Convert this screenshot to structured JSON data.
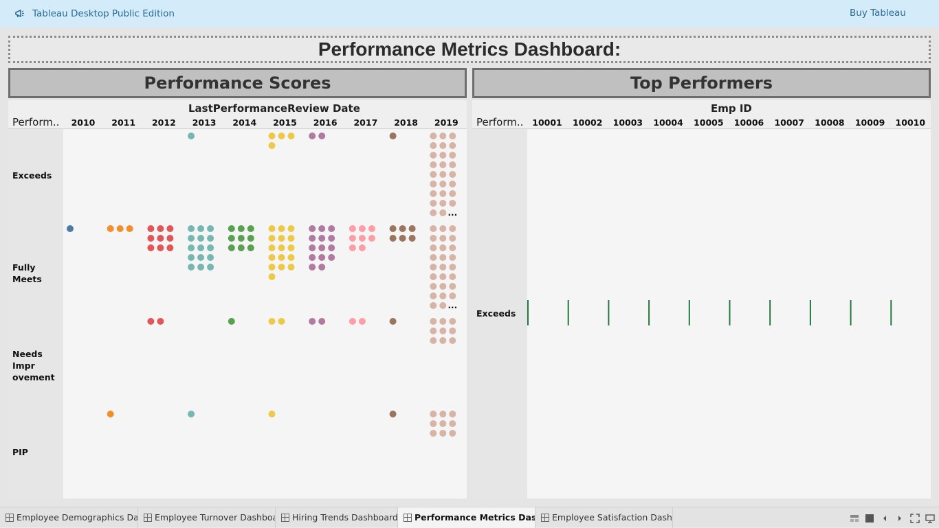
{
  "app": {
    "title": "Tableau Desktop Public Edition",
    "buy_label": "Buy Tableau"
  },
  "dashboard": {
    "title": "Performance Metrics Dashboard:"
  },
  "left_panel": {
    "title": "Performance Scores",
    "column_field": "LastPerformanceReview Date",
    "row_field": "Perform..",
    "columns": [
      "2010",
      "2011",
      "2012",
      "2013",
      "2014",
      "2015",
      "2016",
      "2017",
      "2018",
      "2019"
    ],
    "rows": [
      "Exceeds",
      "Fully Meets",
      "Needs Impr ovement",
      "PIP"
    ],
    "more_indicator": "..."
  },
  "right_panel": {
    "title": "Top Performers",
    "column_field": "Emp ID",
    "row_field": "Perform..",
    "columns": [
      "10001",
      "10002",
      "10003",
      "10004",
      "10005",
      "10006",
      "10007",
      "10008",
      "10009",
      "10010"
    ],
    "rows": [
      "Exceeds"
    ]
  },
  "colors": {
    "2010": "#4e79a7",
    "2011": "#f28e2b",
    "2012": "#e15759",
    "2013": "#76b7b2",
    "2014": "#59a14f",
    "2015": "#edc948",
    "2016": "#b07aa1",
    "2017": "#ff9da7",
    "2018": "#9c755f",
    "2019": "#d7b5a6",
    "tick": "#1f7a3a"
  },
  "chart_data": [
    {
      "type": "scatter",
      "title": "Performance Scores",
      "xlabel": "LastPerformanceReview Date",
      "ylabel": "Perform..",
      "categories": [
        "2010",
        "2011",
        "2012",
        "2013",
        "2014",
        "2015",
        "2016",
        "2017",
        "2018",
        "2019"
      ],
      "series": [
        {
          "name": "Exceeds",
          "values": [
            0,
            0,
            0,
            1,
            0,
            4,
            2,
            0,
            1,
            27
          ]
        },
        {
          "name": "Fully Meets",
          "values": [
            1,
            3,
            9,
            15,
            9,
            16,
            14,
            8,
            6,
            27
          ]
        },
        {
          "name": "Needs Impr ovement",
          "values": [
            0,
            0,
            2,
            0,
            1,
            2,
            2,
            2,
            1,
            9
          ]
        },
        {
          "name": "PIP",
          "values": [
            0,
            1,
            0,
            1,
            0,
            1,
            0,
            0,
            1,
            9
          ]
        }
      ],
      "truncated_cells": [
        {
          "row": "Exceeds",
          "column": "2019"
        },
        {
          "row": "Fully Meets",
          "column": "2019"
        }
      ]
    },
    {
      "type": "bar",
      "title": "Top Performers",
      "xlabel": "Emp ID",
      "ylabel": "Perform..",
      "categories": [
        "10001",
        "10002",
        "10003",
        "10004",
        "10005",
        "10006",
        "10007",
        "10008",
        "10009",
        "10010"
      ],
      "series": [
        {
          "name": "Exceeds",
          "values": [
            1,
            1,
            1,
            1,
            1,
            1,
            1,
            1,
            1,
            1
          ]
        }
      ]
    }
  ],
  "tabs": [
    {
      "label": "Employee Demographics Da...",
      "active": false
    },
    {
      "label": "Employee Turnover Dashboa...",
      "active": false
    },
    {
      "label": "Hiring Trends Dashboard:",
      "active": false
    },
    {
      "label": "Performance Metrics Dash...",
      "active": true
    },
    {
      "label": "Employee Satisfaction Dash...",
      "active": false
    }
  ],
  "controls": [
    "grid-view-icon",
    "single-view-icon",
    "previous-icon",
    "next-icon",
    "fullscreen-icon",
    "present-icon"
  ]
}
